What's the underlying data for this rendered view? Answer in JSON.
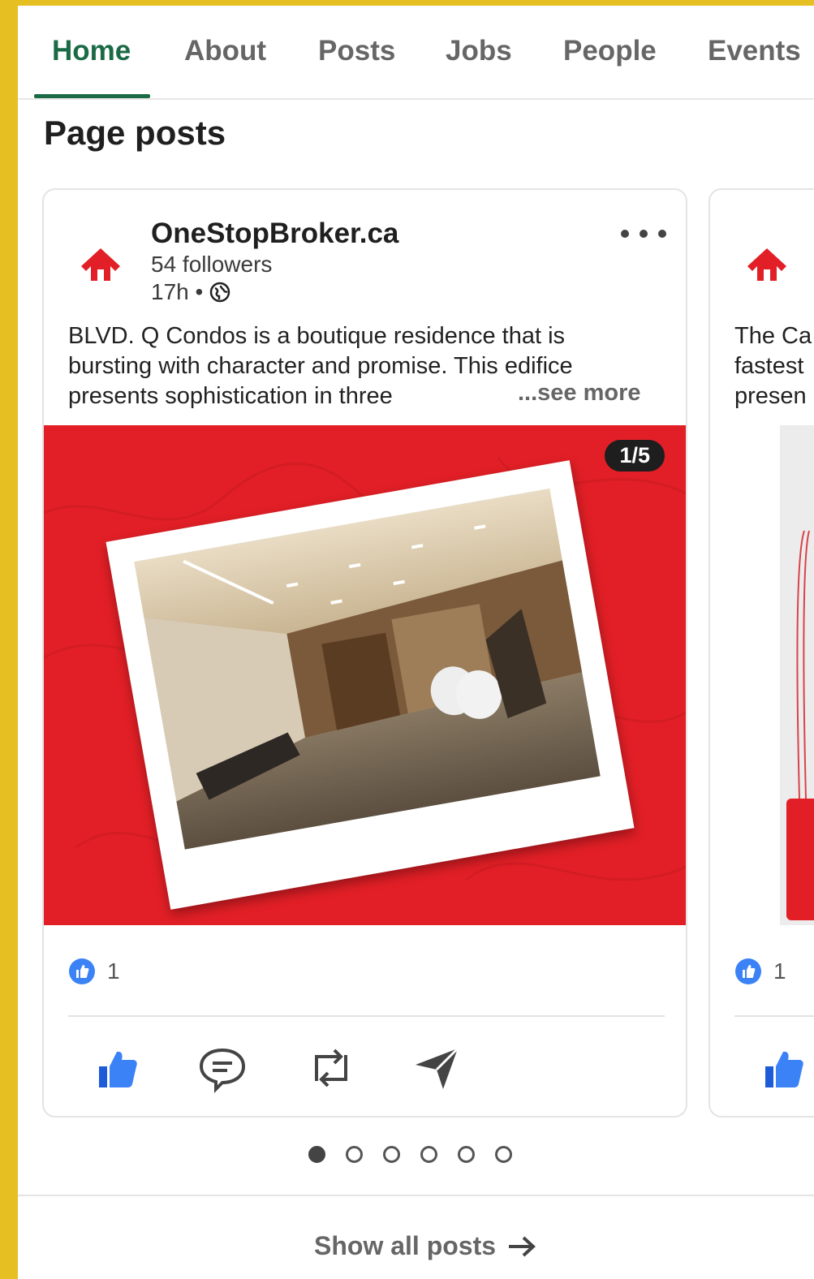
{
  "tabs": [
    {
      "label": "Home",
      "active": true
    },
    {
      "label": "About"
    },
    {
      "label": "Posts"
    },
    {
      "label": "Jobs"
    },
    {
      "label": "People"
    },
    {
      "label": "Events"
    }
  ],
  "page_title": "Page posts",
  "posts": [
    {
      "author": "OneStopBroker.ca",
      "followers": "54 followers",
      "time": "17h •",
      "text": "BLVD. Q Condos is a boutique residence that is bursting with character and promise. This edifice presents sophistication in three",
      "see_more": "...see more",
      "media_counter": "1/5",
      "reaction_count": "1"
    },
    {
      "text": "The Ca fastest presen",
      "reaction_count": "1"
    }
  ],
  "carousel": {
    "count": 6,
    "active_index": 0
  },
  "show_all": "Show all posts",
  "colors": {
    "accent_green": "#1a6b45",
    "brand_red": "#e21f26",
    "like_blue": "#3b82f6",
    "frame_yellow": "#e6bf22"
  },
  "icons": [
    "home-logo-icon",
    "globe-icon",
    "more-icon",
    "like-icon",
    "comment-icon",
    "repost-icon",
    "send-icon",
    "arrow-right-icon"
  ]
}
